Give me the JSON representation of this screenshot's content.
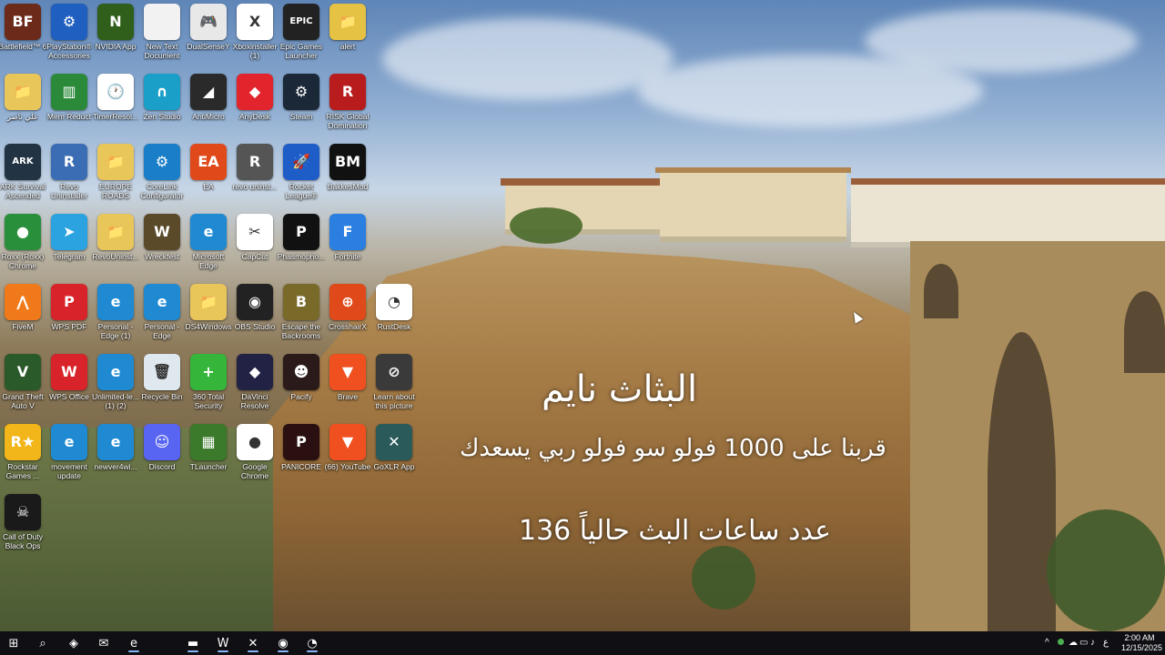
{
  "desktop": {
    "icons": [
      {
        "label": "Battlefield™ 6",
        "color": "#6b2a1a",
        "glyph": "BF"
      },
      {
        "label": "PlayStation® Accessories",
        "color": "#1f5fbf",
        "glyph": "⚙"
      },
      {
        "label": "NVIDIA App",
        "color": "#2f5f1a",
        "glyph": "N"
      },
      {
        "label": "New Text Document",
        "color": "#f2f2f2",
        "glyph": ""
      },
      {
        "label": "DualSenseY",
        "color": "#e8e8e8",
        "glyph": "🎮"
      },
      {
        "label": "Xboxinstaller (1)",
        "color": "#ffffff",
        "glyph": "X"
      },
      {
        "label": "Epic Games Launcher",
        "color": "#222222",
        "glyph": "EPIC"
      },
      {
        "label": "alert",
        "color": "#e5c243",
        "glyph": "📁"
      },
      {
        "label": "علي ناصر",
        "color": "#e9c65a",
        "glyph": "📁"
      },
      {
        "label": "Mem Reduct",
        "color": "#2a8a3a",
        "glyph": "▥"
      },
      {
        "label": "TimerResol...",
        "color": "#ffffff",
        "glyph": "🕐"
      },
      {
        "label": "Zen Studio",
        "color": "#1aa0c8",
        "glyph": "∩"
      },
      {
        "label": "AntiMicro",
        "color": "#2a2a2a",
        "glyph": "◢"
      },
      {
        "label": "AnyDesk",
        "color": "#e2242c",
        "glyph": "◆"
      },
      {
        "label": "Steam",
        "color": "#1b2838",
        "glyph": "⚙"
      },
      {
        "label": "RISK Global Domination",
        "color": "#b81c1c",
        "glyph": "R"
      },
      {
        "label": "ARK Survival Ascended",
        "color": "#223344",
        "glyph": "ARK"
      },
      {
        "label": "Revo Uninstaller",
        "color": "#3a6db3",
        "glyph": "R"
      },
      {
        "label": "EUROPE ROADS",
        "color": "#e9c65a",
        "glyph": "📁"
      },
      {
        "label": "CoreLink Configurator",
        "color": "#1a7fc8",
        "glyph": "⚙"
      },
      {
        "label": "EA",
        "color": "#e04a1a",
        "glyph": "EA"
      },
      {
        "label": "revo uninst...",
        "color": "#555555",
        "glyph": "R"
      },
      {
        "label": "Rocket League®",
        "color": "#1e5cc8",
        "glyph": "🚀"
      },
      {
        "label": "BakkesMod",
        "color": "#111111",
        "glyph": "BM"
      },
      {
        "label": "Roxx (Roxx) Chrome",
        "color": "#2a8f3a",
        "glyph": "●"
      },
      {
        "label": "Telegram",
        "color": "#2aa3e0",
        "glyph": "➤"
      },
      {
        "label": "RevoUninst...",
        "color": "#e9c65a",
        "glyph": "📁"
      },
      {
        "label": "Wreckfest",
        "color": "#5a4a2a",
        "glyph": "W"
      },
      {
        "label": "Microsoft Edge",
        "color": "#1f8ad2",
        "glyph": "e"
      },
      {
        "label": "CapCut",
        "color": "#ffffff",
        "glyph": "✂"
      },
      {
        "label": "Phasmopho...",
        "color": "#111111",
        "glyph": "P"
      },
      {
        "label": "Fortnite",
        "color": "#2a7fe0",
        "glyph": "F"
      },
      {
        "label": "FiveM",
        "color": "#f07a1a",
        "glyph": "⋀"
      },
      {
        "label": "WPS PDF",
        "color": "#d8232a",
        "glyph": "P"
      },
      {
        "label": "Personal - Edge (1)",
        "color": "#1f8ad2",
        "glyph": "e"
      },
      {
        "label": "Personal - Edge",
        "color": "#1f8ad2",
        "glyph": "e"
      },
      {
        "label": "DS4Windows",
        "color": "#e9c65a",
        "glyph": "📁"
      },
      {
        "label": "OBS Studio",
        "color": "#222222",
        "glyph": "◉"
      },
      {
        "label": "Escape the Backrooms",
        "color": "#7a6a2a",
        "glyph": "B"
      },
      {
        "label": "CrosshairX",
        "color": "#e04a1a",
        "glyph": "⊕"
      },
      {
        "label": "RustDesk",
        "color": "#ffffff",
        "glyph": "◔"
      },
      {
        "label": "Grand Theft Auto V",
        "color": "#2a5a2a",
        "glyph": "V"
      },
      {
        "label": "WPS Office",
        "color": "#d8232a",
        "glyph": "W"
      },
      {
        "label": "Unlimited-le... (1) (2)",
        "color": "#1f8ad2",
        "glyph": "e"
      },
      {
        "label": "Recycle Bin",
        "color": "#dfe8ef",
        "glyph": "🗑"
      },
      {
        "label": "360 Total Security",
        "color": "#35b53a",
        "glyph": "+"
      },
      {
        "label": "DaVinci Resolve",
        "color": "#222244",
        "glyph": "◆"
      },
      {
        "label": "Pacify",
        "color": "#2a1a1a",
        "glyph": "☻"
      },
      {
        "label": "Brave",
        "color": "#f05020",
        "glyph": "▼"
      },
      {
        "label": "Learn about this picture",
        "color": "#3a3a3a",
        "glyph": "⊘"
      },
      {
        "label": "Rockstar Games ...",
        "color": "#f2b61a",
        "glyph": "R★"
      },
      {
        "label": "movement update",
        "color": "#1f8ad2",
        "glyph": "e"
      },
      {
        "label": "newver4wi...",
        "color": "#1f8ad2",
        "glyph": "e"
      },
      {
        "label": "Discord",
        "color": "#5865f2",
        "glyph": "☺"
      },
      {
        "label": "TLauncher",
        "color": "#3a7a2a",
        "glyph": "▦"
      },
      {
        "label": "Google Chrome",
        "color": "#ffffff",
        "glyph": "●"
      },
      {
        "label": "PANICORE",
        "color": "#2a1010",
        "glyph": "P"
      },
      {
        "label": "(66) YouTube",
        "color": "#f05020",
        "glyph": "▼"
      },
      {
        "label": "GoXLR App",
        "color": "#2a5a5a",
        "glyph": "✕"
      },
      {
        "label": "Call of Duty Black Ops",
        "color": "#1a1a1a",
        "glyph": "☠"
      }
    ],
    "overlay": {
      "title": "البثاث نايم",
      "subtitle": "قربنا على 1000 فولو سو فولو ربي يسعدك",
      "hours": "عدد ساعات البث حالياً 136"
    }
  },
  "taskbar": {
    "items": [
      {
        "name": "start-button",
        "glyph": "⊞"
      },
      {
        "name": "search-button",
        "glyph": "⌕"
      },
      {
        "name": "copilot-button",
        "glyph": "◈"
      },
      {
        "name": "mail-button",
        "glyph": "✉"
      },
      {
        "name": "edge-taskbar-button",
        "glyph": "e"
      },
      {
        "name": "file-explorer-button",
        "glyph": "▬"
      },
      {
        "name": "wps-taskbar-button",
        "glyph": "W"
      },
      {
        "name": "goxlr-taskbar-button",
        "glyph": "✕"
      },
      {
        "name": "obs-taskbar-button",
        "glyph": "◉"
      },
      {
        "name": "clock-app-button",
        "glyph": "◔"
      }
    ],
    "tray": {
      "chevron": "^",
      "language": "ع",
      "time": "2:00 AM",
      "date": "12/15/2025"
    }
  }
}
